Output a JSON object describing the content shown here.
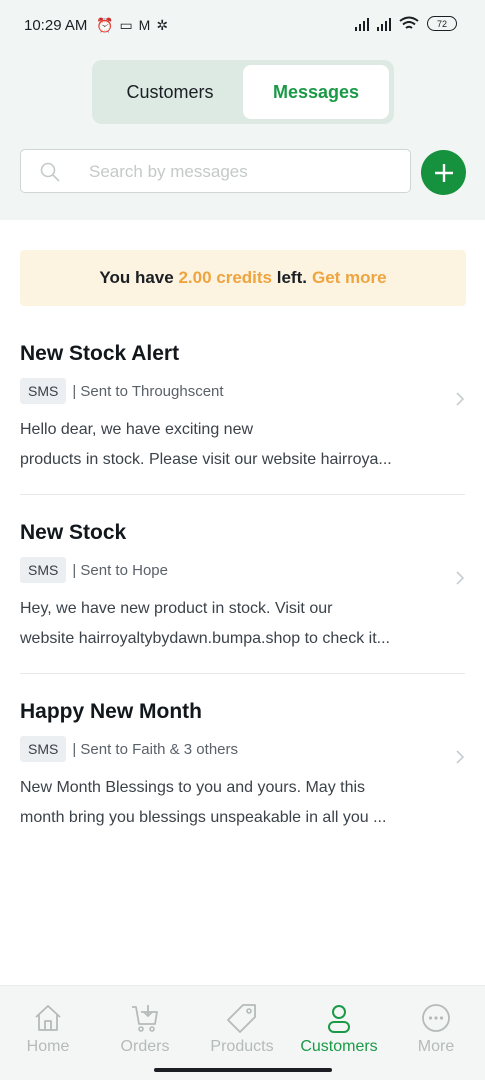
{
  "status_bar": {
    "time": "10:29 AM",
    "battery": "72"
  },
  "tabs": [
    {
      "label": "Customers",
      "active": false
    },
    {
      "label": "Messages",
      "active": true
    }
  ],
  "search": {
    "placeholder": "Search by messages",
    "icon": "search-icon"
  },
  "add_button": {
    "icon": "plus-icon"
  },
  "credits": {
    "prefix": "You have",
    "amount": "2.00 credits",
    "suffix": "left.",
    "action": "Get more"
  },
  "messages": [
    {
      "title": "New Stock Alert",
      "channel": "SMS",
      "recipient": "| Sent to Throughscent",
      "body_line1": "Hello dear, we have exciting new",
      "body_line2": "products in stock. Please visit our website hairroya..."
    },
    {
      "title": "New Stock",
      "channel": "SMS",
      "recipient": "| Sent to Hope",
      "body_line1": "Hey, we have new product in stock. Visit our",
      "body_line2": "website hairroyaltybydawn.bumpa.shop to check it..."
    },
    {
      "title": "Happy New Month",
      "channel": "SMS",
      "recipient": "| Sent to Faith & 3 others",
      "body_line1": "New Month Blessings to you and yours. May this",
      "body_line2": "month bring you blessings unspeakable in all you ..."
    }
  ],
  "bottom_nav": [
    {
      "label": "Home",
      "icon": "home-icon",
      "active": false
    },
    {
      "label": "Orders",
      "icon": "cart-icon",
      "active": false
    },
    {
      "label": "Products",
      "icon": "tag-icon",
      "active": false
    },
    {
      "label": "Customers",
      "icon": "user-icon",
      "active": true
    },
    {
      "label": "More",
      "icon": "more-icon",
      "active": false
    }
  ],
  "colors": {
    "brand_green": "#1a9a47",
    "credit_orange": "#eea43f",
    "banner_bg": "#fdf3e1"
  }
}
